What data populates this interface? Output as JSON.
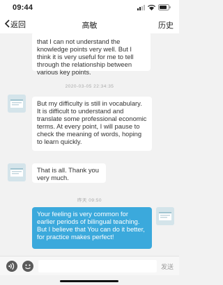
{
  "status_bar": {
    "time": "09:44",
    "icons": [
      "signal-icon",
      "wifi-icon",
      "battery-icon"
    ]
  },
  "nav": {
    "back_label": "返回",
    "title": "高敏",
    "history_label": "历史"
  },
  "messages": [
    {
      "sender": "other",
      "text": "that I can not understand the knowledge points very well. But I think it is very useful for me to tell through the relationship between various key points.",
      "partial_top": true
    },
    {
      "type": "timestamp",
      "text": "2020-03-05 22:34:35"
    },
    {
      "sender": "other",
      "text": "But my difficulty is still in vocabulary. It is difficult to understand and translate some professional economic terms. At every point, I will pause to check the meaning of words, hoping to learn quickly."
    },
    {
      "sender": "other",
      "text": "That is all. Thank you very much."
    },
    {
      "type": "timestamp",
      "text": "昨天 09:50"
    },
    {
      "sender": "self",
      "text": "Your feeling is very common for earlier periods of bilingual teaching. But I believe that You can do it better, for practice makes perfect!"
    }
  ],
  "input_bar": {
    "placeholder": "",
    "send_label": "发送"
  },
  "colors": {
    "self_bubble": "#3ba9dc",
    "other_bubble": "#ffffff",
    "background": "#f2f2f2"
  }
}
